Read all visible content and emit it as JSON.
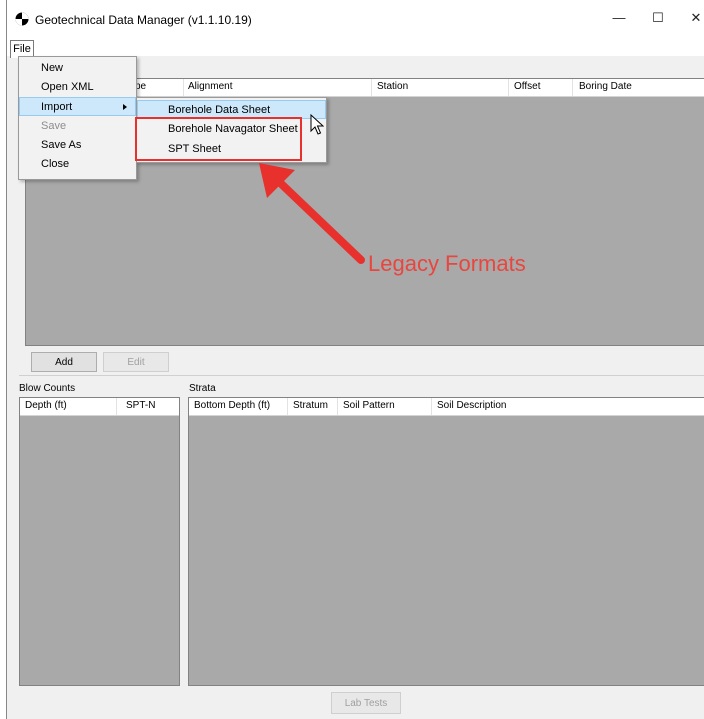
{
  "window": {
    "title": "Geotechnical Data Manager (v1.1.10.19)",
    "minimize_glyph": "—",
    "maximize_glyph": "☐",
    "close_glyph": "✕"
  },
  "menubar": {
    "file_label": "File"
  },
  "file_menu": {
    "items": [
      {
        "label": "New",
        "enabled": true
      },
      {
        "label": "Open XML",
        "enabled": true
      },
      {
        "label": "Import",
        "enabled": true,
        "highlighted": true,
        "submenu": true
      },
      {
        "label": "Save",
        "enabled": false
      },
      {
        "label": "Save As",
        "enabled": true
      },
      {
        "label": "Close",
        "enabled": true
      }
    ]
  },
  "import_submenu": {
    "items": [
      {
        "label": "Borehole Data Sheet",
        "highlighted": true
      },
      {
        "label": "Borehole Navagator Sheet"
      },
      {
        "label": "SPT Sheet"
      }
    ]
  },
  "boring_table": {
    "columns": [
      "pe",
      "Alignment",
      "Station",
      "Offset",
      "Boring Date"
    ]
  },
  "boring_buttons": {
    "add_label": "Add",
    "edit_label": "Edit"
  },
  "blow_counts": {
    "group_label": "Blow Counts",
    "columns": [
      "Depth (ft)",
      "SPT-N"
    ]
  },
  "strata": {
    "group_label": "Strata",
    "columns": [
      "Bottom Depth (ft)",
      "Stratum",
      "Soil Pattern",
      "Soil Description"
    ]
  },
  "lab_tests_label": "Lab Tests",
  "annotation": {
    "text": "Legacy Formats",
    "color": "#e8463f"
  },
  "colors": {
    "grid_bg": "#a9a9a9",
    "highlight": "#cde8fb",
    "annotation_red": "#e8302c"
  }
}
